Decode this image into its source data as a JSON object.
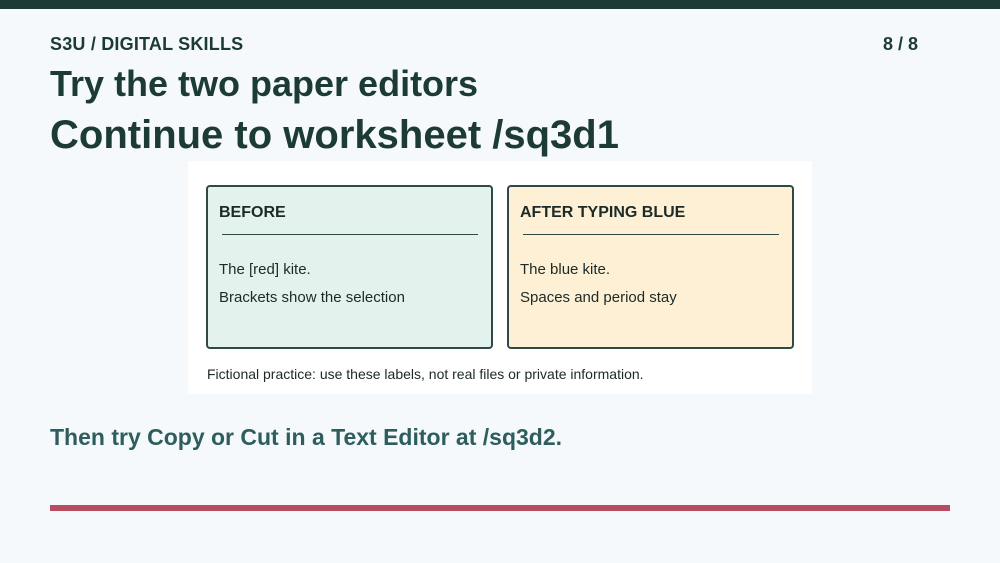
{
  "header": {
    "course_label": "S3U / DIGITAL SKILLS",
    "page_counter": "8 / 8"
  },
  "titles": {
    "line1": "Try the two paper editors",
    "line2": "Continue to worksheet /sq3d1"
  },
  "cards": {
    "before": {
      "heading": "BEFORE",
      "line1": "The [red] kite.",
      "line2": "Brackets show the selection"
    },
    "after": {
      "heading": "AFTER TYPING BLUE",
      "line1": "The blue kite.",
      "line2": "Spaces and period stay"
    }
  },
  "footnote": "Fictional practice: use these labels, not real files or private information.",
  "followup": "Then try Copy or Cut in a Text Editor at /sq3d2.",
  "colors": {
    "primary": "#1c3a36",
    "background": "#f5f9fc",
    "before_card": "#e4f2ed",
    "after_card": "#fdf0d4",
    "accent_bar": "#b84d62",
    "followup_text": "#2d5e5d"
  }
}
